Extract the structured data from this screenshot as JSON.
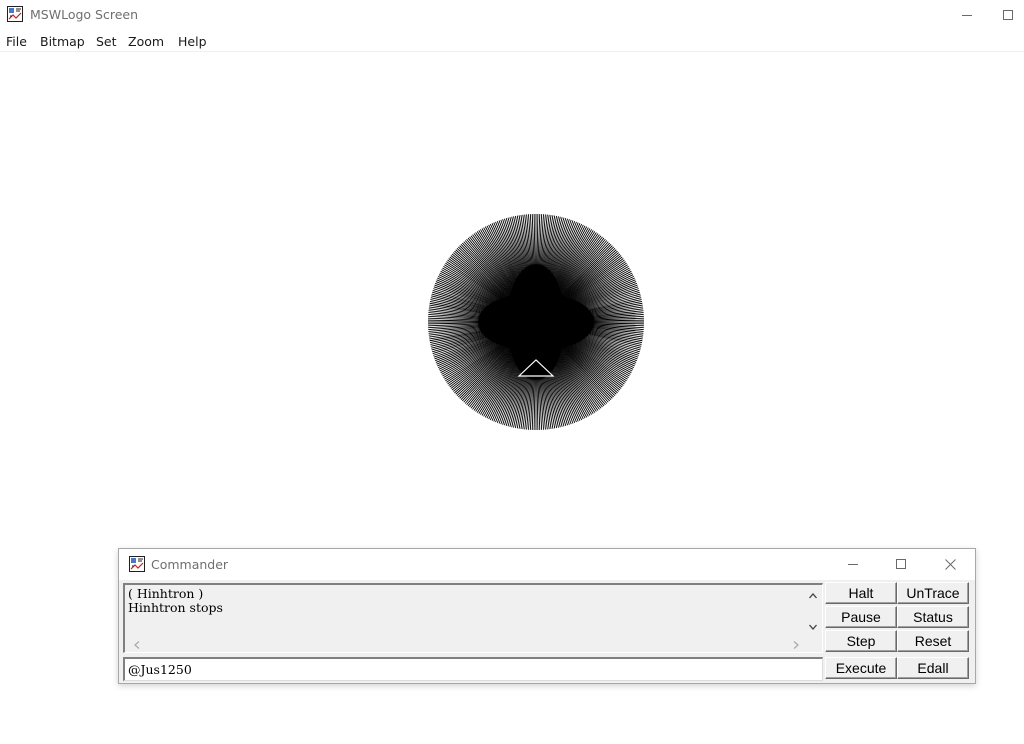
{
  "main_window": {
    "title": "MSWLogo Screen",
    "icon": "mswlogo-app-icon",
    "controls": [
      "minimize-icon",
      "maximize-icon"
    ]
  },
  "menu": {
    "items": [
      "File",
      "Bitmap",
      "Set",
      "Zoom",
      "Help"
    ]
  },
  "canvas": {
    "background": "#ffffff",
    "drawing": "radial line pattern (black circle of lines)",
    "turtle_icon": "turtle-triangle-icon",
    "drawing_color": "#000000"
  },
  "commander": {
    "title": "Commander",
    "icon": "mswlogo-app-icon",
    "controls": [
      "minimize-icon",
      "maximize-icon",
      "close-icon"
    ],
    "history_lines": [
      "( Hinhtron )",
      "Hinhtron stops"
    ],
    "input_value": "@Jus1250",
    "buttons": {
      "halt": "Halt",
      "untrace": "UnTrace",
      "pause": "Pause",
      "status": "Status",
      "step": "Step",
      "reset": "Reset",
      "execute": "Execute",
      "edall": "Edall"
    }
  }
}
